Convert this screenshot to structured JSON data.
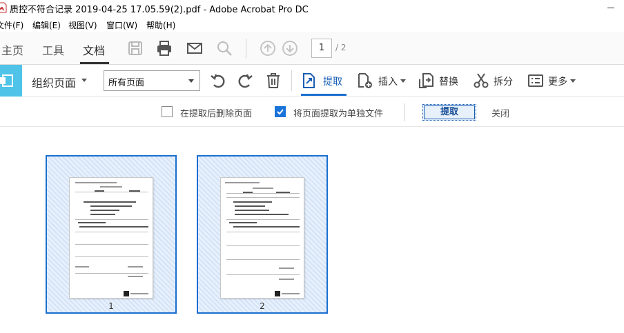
{
  "window": {
    "title": "质控不符合记录 2019-04-25 17.05.59(2).pdf - Adobe Acrobat Pro DC"
  },
  "menu": {
    "items": [
      "文件(F)",
      "编辑(E)",
      "视图(V)",
      "窗口(W)",
      "帮助(H)"
    ]
  },
  "nav": {
    "tabs": [
      "主页",
      "工具",
      "文档"
    ],
    "active_tab": "文档",
    "current_page": "1",
    "page_total": "/ 2"
  },
  "organize": {
    "title": "组织页面",
    "page_range_select": "所有页面",
    "buttons": {
      "extract": "提取",
      "insert": "插入",
      "replace": "替换",
      "split": "拆分",
      "more": "更多"
    }
  },
  "extract_options": {
    "delete_after_extract": "在提取后删除页面",
    "delete_after_extract_checked": false,
    "extract_as_separate": "将页面提取为单独文件",
    "extract_as_separate_checked": true,
    "extract_button": "提取",
    "close_button": "关闭"
  },
  "thumbnails": [
    {
      "label": "1",
      "selected": true
    },
    {
      "label": "2",
      "selected": true
    }
  ],
  "colors": {
    "accent": "#1a6fd0",
    "tool_block": "#4fc3e8"
  }
}
